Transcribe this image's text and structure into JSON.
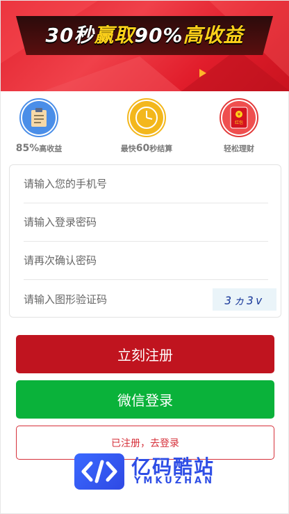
{
  "banner": {
    "title_part1": "30秒",
    "title_highlight1": "赢取",
    "title_part2": "90%",
    "title_highlight2": "高收益"
  },
  "features": [
    {
      "icon": "clipboard-icon",
      "label_big": "85%",
      "label": "高收益",
      "color": "#4a8ee8"
    },
    {
      "icon": "clock-icon",
      "label_prefix": "最快",
      "label_big": "60",
      "label": "秒结算",
      "color": "#f3b71c"
    },
    {
      "icon": "red-envelope-icon",
      "label": "轻松理财",
      "envelope_text": "红包",
      "color": "#e23a3a"
    }
  ],
  "form": {
    "phone_placeholder": "请输入您的手机号",
    "password_placeholder": "请输入登录密码",
    "confirm_placeholder": "请再次确认密码",
    "captcha_placeholder": "请输入图形验证码",
    "captcha_text": "3ヵ3v"
  },
  "buttons": {
    "register": "立刻注册",
    "wechat_login": "微信登录",
    "already_registered": "已注册，去登录"
  },
  "watermark": {
    "brand": "亿码酷站",
    "subtitle": "YMKUZHAN"
  },
  "colors": {
    "banner_red": "#e2232f",
    "register_red": "#c0141f",
    "wechat_green": "#0ab23a",
    "watermark_blue": "#2e4ee6"
  }
}
